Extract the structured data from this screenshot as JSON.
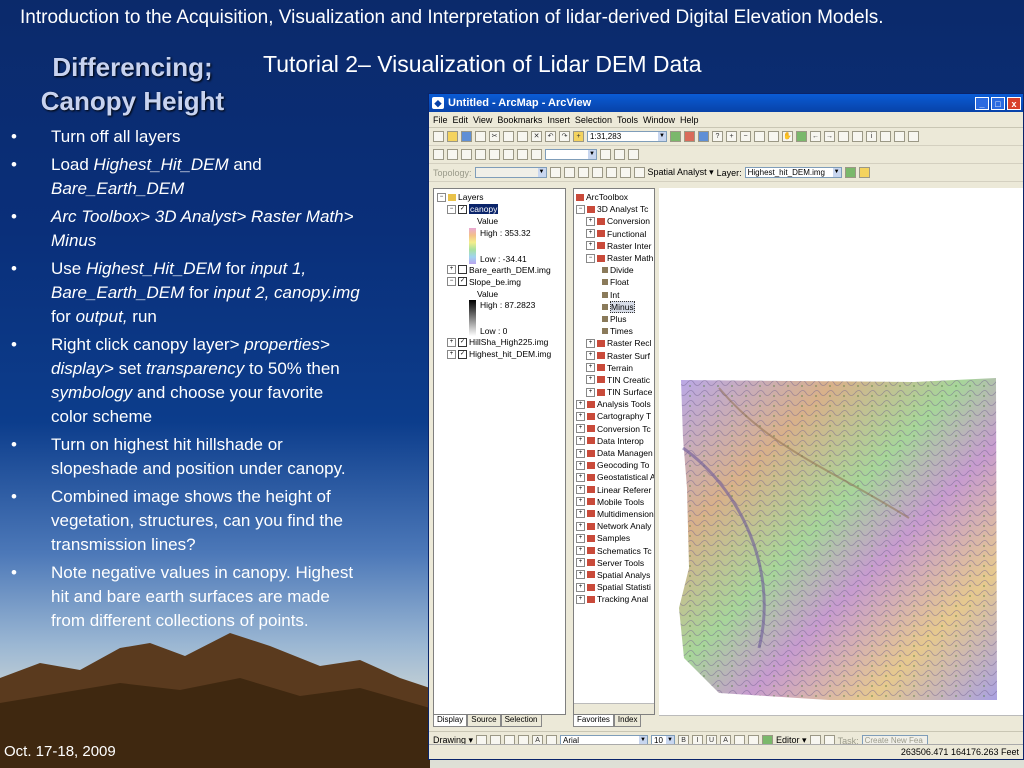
{
  "slide": {
    "header": "Introduction to the Acquisition, Visualization and Interpretation of lidar-derived Digital Elevation Models.",
    "title": "Differencing; Canopy Height",
    "subtitle": "Tutorial 2– Visualization of Lidar DEM Data",
    "bullet_marker": "•",
    "bullets": [
      [
        {
          "t": "Turn off all layers"
        }
      ],
      [
        {
          "t": "Load "
        },
        {
          "t": "Highest_Hit_DEM",
          "i": true
        },
        {
          "t": " and "
        },
        {
          "t": "Bare_Earth_DEM",
          "i": true
        }
      ],
      [
        {
          "t": "Arc Toolbox>  3D Analyst>  Raster Math> Minus",
          "i": true
        }
      ],
      [
        {
          "t": "Use "
        },
        {
          "t": "Highest_Hit_DEM",
          "i": true
        },
        {
          "t": " for "
        },
        {
          "t": "input 1, Bare_Earth_DEM",
          "i": true
        },
        {
          "t": " for "
        },
        {
          "t": "input 2, canopy.img",
          "i": true
        },
        {
          "t": " for "
        },
        {
          "t": "output,",
          "i": true
        },
        {
          "t": " run"
        }
      ],
      [
        {
          "t": "Right click canopy layer> "
        },
        {
          "t": "properties> display>",
          "i": true
        },
        {
          "t": " set "
        },
        {
          "t": "transparency",
          "i": true
        },
        {
          "t": " to 50% then "
        },
        {
          "t": "symbology",
          "i": true
        },
        {
          "t": " and choose your favorite color scheme"
        }
      ],
      [
        {
          "t": "Turn on highest hit hillshade or slopeshade and position under canopy."
        }
      ],
      [
        {
          "t": "Combined image shows the height of vegetation, structures, can you find the transmission lines?"
        }
      ],
      [
        {
          "t": "Note negative values in canopy. Highest hit and bare earth surfaces are made from different collections of points."
        }
      ]
    ],
    "date": "Oct. 17-18, 2009"
  },
  "arcmap": {
    "window_title": "Untitled - ArcMap - ArcView",
    "window_buttons": {
      "minimize": "_",
      "maximize": "□",
      "close": "x"
    },
    "menu": [
      "File",
      "Edit",
      "View",
      "Bookmarks",
      "Insert",
      "Selection",
      "Tools",
      "Window",
      "Help"
    ],
    "scale": "1:31,283",
    "topology_label": "Topology:",
    "spatial_analyst_label": "Spatial Analyst ▾",
    "layer_label": "Layer:",
    "layer_value": "Highest_hit_DEM.img",
    "toc": {
      "root": "Layers",
      "canopy": "canopy",
      "canopy_value": "Value",
      "canopy_high": "High : 353.32",
      "canopy_low": "Low : -34.41",
      "bare_earth": "Bare_earth_DEM.img",
      "slope": "Slope_be.img",
      "slope_value": "Value",
      "slope_high": "High : 87.2823",
      "slope_low": "Low : 0",
      "hillsha": "HillSha_High225.img",
      "highest": "Highest_hit_DEM.img",
      "tabs": [
        "Display",
        "Source",
        "Selection"
      ]
    },
    "toolbox": {
      "root": "ArcToolbox",
      "items": [
        {
          "label": "3D Analyst Tc",
          "level": 1,
          "pm": "⊟"
        },
        {
          "label": "Conversion",
          "level": 2,
          "pm": "⊞"
        },
        {
          "label": "Functional",
          "level": 2,
          "pm": "⊞"
        },
        {
          "label": "Raster Inter",
          "level": 2,
          "pm": "⊞"
        },
        {
          "label": "Raster Math",
          "level": 2,
          "pm": "⊟"
        },
        {
          "label": "Divide",
          "level": 3,
          "pm": ""
        },
        {
          "label": "Float",
          "level": 3,
          "pm": ""
        },
        {
          "label": "Int",
          "level": 3,
          "pm": ""
        },
        {
          "label": "Minus",
          "level": 3,
          "pm": "",
          "selected": true
        },
        {
          "label": "Plus",
          "level": 3,
          "pm": ""
        },
        {
          "label": "Times",
          "level": 3,
          "pm": ""
        },
        {
          "label": "Raster Recl",
          "level": 2,
          "pm": "⊞"
        },
        {
          "label": "Raster Surf",
          "level": 2,
          "pm": "⊞"
        },
        {
          "label": "Terrain",
          "level": 2,
          "pm": "⊞"
        },
        {
          "label": "TIN Creatic",
          "level": 2,
          "pm": "⊞"
        },
        {
          "label": "TIN Surface",
          "level": 2,
          "pm": "⊞"
        },
        {
          "label": "Analysis Tools",
          "level": 1,
          "pm": "⊞"
        },
        {
          "label": "Cartography T",
          "level": 1,
          "pm": "⊞"
        },
        {
          "label": "Conversion Tc",
          "level": 1,
          "pm": "⊞"
        },
        {
          "label": "Data Interop",
          "level": 1,
          "pm": "⊞"
        },
        {
          "label": "Data Managen",
          "level": 1,
          "pm": "⊞"
        },
        {
          "label": "Geocoding To",
          "level": 1,
          "pm": "⊞"
        },
        {
          "label": "Geostatistical A",
          "level": 1,
          "pm": "⊞"
        },
        {
          "label": "Linear Referer",
          "level": 1,
          "pm": "⊞"
        },
        {
          "label": "Mobile Tools",
          "level": 1,
          "pm": "⊞"
        },
        {
          "label": "Multidimension",
          "level": 1,
          "pm": "⊞"
        },
        {
          "label": "Network Analy",
          "level": 1,
          "pm": "⊞"
        },
        {
          "label": "Samples",
          "level": 1,
          "pm": "⊞"
        },
        {
          "label": "Schematics Tc",
          "level": 1,
          "pm": "⊞"
        },
        {
          "label": "Server Tools",
          "level": 1,
          "pm": "⊞"
        },
        {
          "label": "Spatial Analys",
          "level": 1,
          "pm": "⊞"
        },
        {
          "label": "Spatial Statisti",
          "level": 1,
          "pm": "⊞"
        },
        {
          "label": "Tracking Anal",
          "level": 1,
          "pm": "⊞"
        }
      ],
      "tabs": [
        "Favorites",
        "Index"
      ]
    },
    "drawing_label": "Drawing ▾",
    "font_name": "Arial",
    "font_size": "10",
    "editor_label": "Editor ▾",
    "task_label": "Task:",
    "task_value": "Create New Fea",
    "coordinates": "263506.471  164176.263 Feet"
  }
}
